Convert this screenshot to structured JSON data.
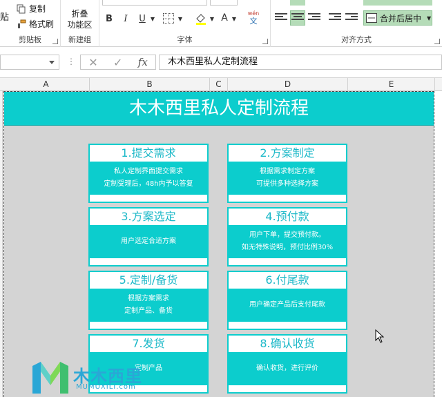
{
  "ribbon": {
    "clipboard": {
      "paste_label": "贴",
      "copy_label": "复制",
      "format_painter_label": "格式刷",
      "group_label": "剪贴板"
    },
    "new_group": {
      "fold_label": "折叠",
      "fold_label_2": "功能区",
      "group_label": "新建组"
    },
    "font": {
      "bold_label": "B",
      "italic_label": "I",
      "underline_label": "U",
      "fontcolor_label": "A",
      "wen_label": "wén",
      "wen_char": "文",
      "group_label": "字体"
    },
    "alignment": {
      "merge_label": "合并后居中",
      "group_label": "对齐方式"
    }
  },
  "formula_bar": {
    "content": "木木西里私人定制流程"
  },
  "columns": [
    "A",
    "B",
    "C",
    "D",
    "E"
  ],
  "sheet": {
    "banner_title": "木木西里私人定制流程",
    "cards": [
      {
        "title": "1.提交需求",
        "line1": "私人定制界面提交需求",
        "line2": "定制受理后，48h内予以答复"
      },
      {
        "title": "2.方案制定",
        "line1": "根据需求制定方案",
        "line2": "可提供多种选择方案"
      },
      {
        "title": "3.方案选定",
        "line1": "用户选定合适方案",
        "line2": ""
      },
      {
        "title": "4.预付款",
        "line1": "用户下单，提交预付款。",
        "line2": "如无特殊说明，预付比例30%"
      },
      {
        "title": "5.定制/备货",
        "line1": "根据方案需求",
        "line2": "定制产品、备货"
      },
      {
        "title": "6.付尾款",
        "line1": "用户确定产品后支付尾款",
        "line2": ""
      },
      {
        "title": "7.发货",
        "line1": "定制产品",
        "line2": ""
      },
      {
        "title": "8.确认收货",
        "line1": "确认收货，进行评价",
        "line2": ""
      }
    ]
  },
  "watermark": {
    "name_cn": "木木西里",
    "name_en": "MUMUXILI.com"
  },
  "colors": {
    "accent": "#0ccdcd",
    "title_text": "#1bb8c8",
    "sheet_bg": "#d4d4d4"
  }
}
